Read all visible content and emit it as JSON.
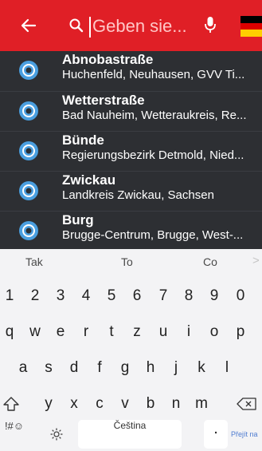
{
  "search": {
    "placeholder": "Geben sie..."
  },
  "colors": {
    "topbar": "#e01f26",
    "list_bg": "#2d2f33",
    "pin": "#4a9fe0",
    "keyboard_bg": "#f3f3f5"
  },
  "icons": {
    "back": "back-arrow-icon",
    "search": "search-icon",
    "mic": "microphone-icon",
    "flag": "german-flag-icon",
    "pin": "location-pin-icon"
  },
  "results": [
    {
      "title": "Abnobastraße",
      "subtitle": "Huchenfeld, Neuhausen, GVV Ti..."
    },
    {
      "title": "Wetterstraße",
      "subtitle": "Bad Nauheim, Wetteraukreis, Re..."
    },
    {
      "title": "Bünde",
      "subtitle": "Regierungsbezirk Detmold, Nied..."
    },
    {
      "title": "Zwickau",
      "subtitle": "Landkreis Zwickau, Sachsen"
    },
    {
      "title": "Burg",
      "subtitle": "Brugge-Centrum, Brugge, West-..."
    }
  ],
  "keyboard": {
    "suggestions": [
      "Tak",
      "To",
      "Co"
    ],
    "suggestion_more": ">",
    "row_numbers": [
      "1",
      "2",
      "3",
      "4",
      "5",
      "6",
      "7",
      "8",
      "9",
      "0"
    ],
    "row1": [
      "q",
      "w",
      "e",
      "r",
      "t",
      "z",
      "u",
      "i",
      "o",
      "p"
    ],
    "row2": [
      "a",
      "s",
      "d",
      "f",
      "g",
      "h",
      "j",
      "k",
      "l"
    ],
    "row3": [
      "y",
      "x",
      "c",
      "v",
      "b",
      "n",
      "m"
    ],
    "symbols_label": "!#☺",
    "space_label": "Čeština",
    "period_label": ".",
    "go_label": "Přejít na"
  }
}
